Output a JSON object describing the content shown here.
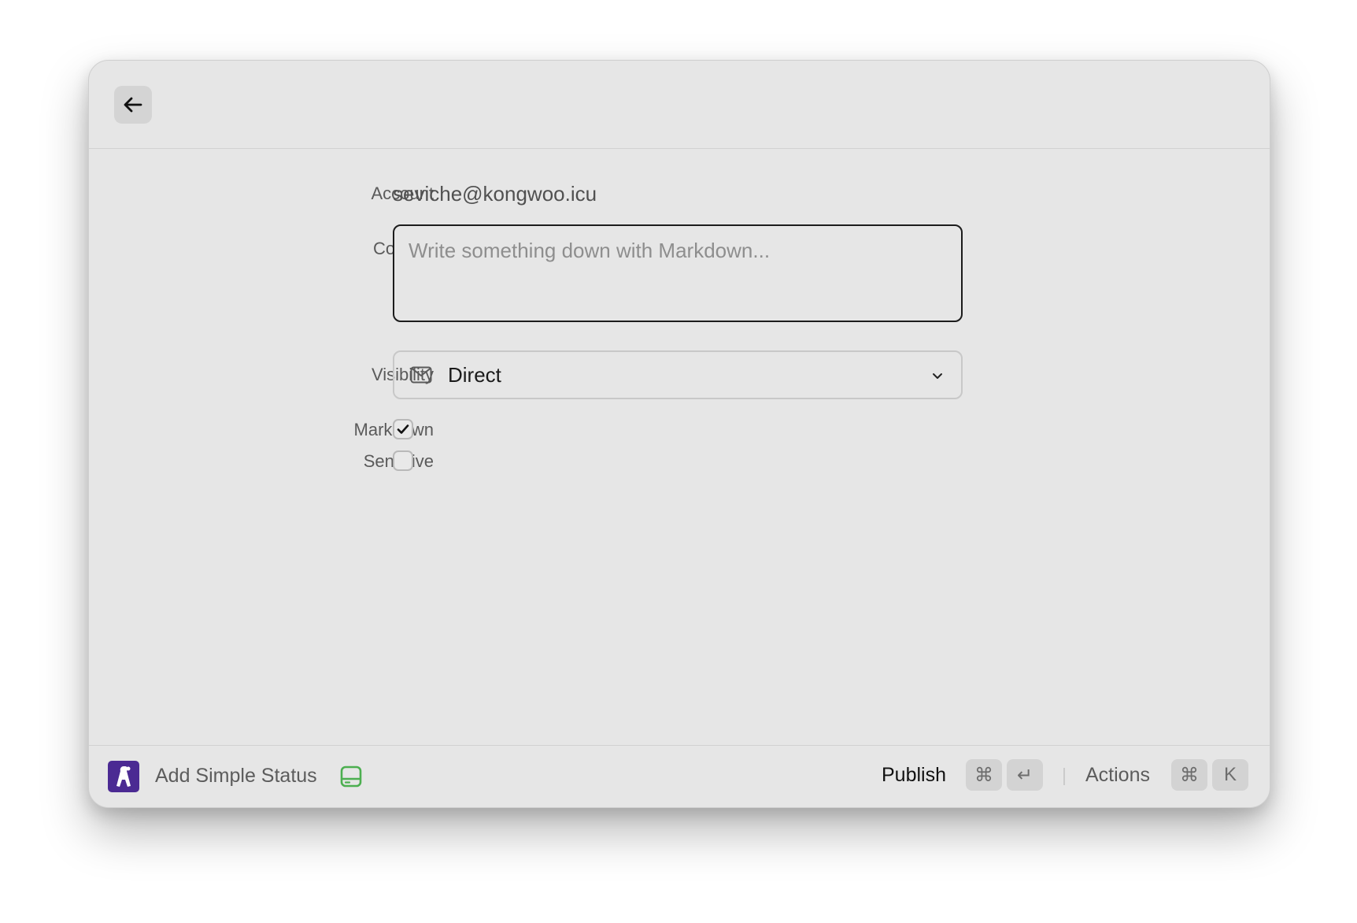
{
  "topbar": {
    "back_icon": "arrow-left-icon"
  },
  "form": {
    "account_label": "Account",
    "account_value": "seviche@kongwoo.icu",
    "content_label": "Content",
    "content_placeholder": "Write something down with Markdown...",
    "content_value": "",
    "visibility_label": "Visibility",
    "visibility_icon": "mail-icon",
    "visibility_value": "Direct",
    "markdown_label": "Markdown",
    "markdown_checked": true,
    "sensitive_label": "Sensitive",
    "sensitive_checked": false
  },
  "footer": {
    "app_icon": "app-logo-icon",
    "app_title": "Add Simple Status",
    "storage_icon": "hard-drive-icon",
    "storage_icon_color": "#4caf50",
    "publish_label": "Publish",
    "publish_shortcut": [
      "⌘",
      "↵"
    ],
    "actions_label": "Actions",
    "actions_shortcut": [
      "⌘",
      "K"
    ]
  },
  "colors": {
    "window_bg": "#e6e6e6",
    "app_icon_bg": "#4b2a93"
  }
}
